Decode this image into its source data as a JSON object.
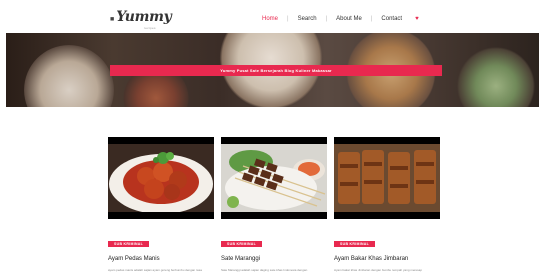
{
  "header": {
    "logo_mark": "■",
    "logo_text": "Yummy",
    "logo_sub": "recipes",
    "nav": [
      {
        "label": "Home",
        "active": true
      },
      {
        "label": "Search",
        "active": false
      },
      {
        "label": "About Me",
        "active": false
      },
      {
        "label": "Contact",
        "active": false
      }
    ],
    "nav_separator": "|",
    "heart_icon": "heart-icon",
    "heart_glyph": "♥"
  },
  "hero": {
    "banner_text": "Yummy Pusat Sate Bersejarah Blog Kuliner Makassar"
  },
  "cards": [
    {
      "badge": "SUB KRIMINAL",
      "title": "Ayam Pedas Manis",
      "text": "ayam pedas manis adalah sajian ayam goreng berbumbu dengan rasa"
    },
    {
      "badge": "SUB KRIMINAL",
      "title": "Sate Maranggi",
      "text": "Sate Maranggi adalah sajian daging sate khas Indonesia dengan"
    },
    {
      "badge": "SUB KRIMINAL",
      "title": "Ayam Bakar Khas Jimbaran",
      "text": "Ayam bakar khas Jimbaran dengan bumbu rempah yang meresap"
    }
  ],
  "colors": {
    "accent": "#e8294f"
  }
}
